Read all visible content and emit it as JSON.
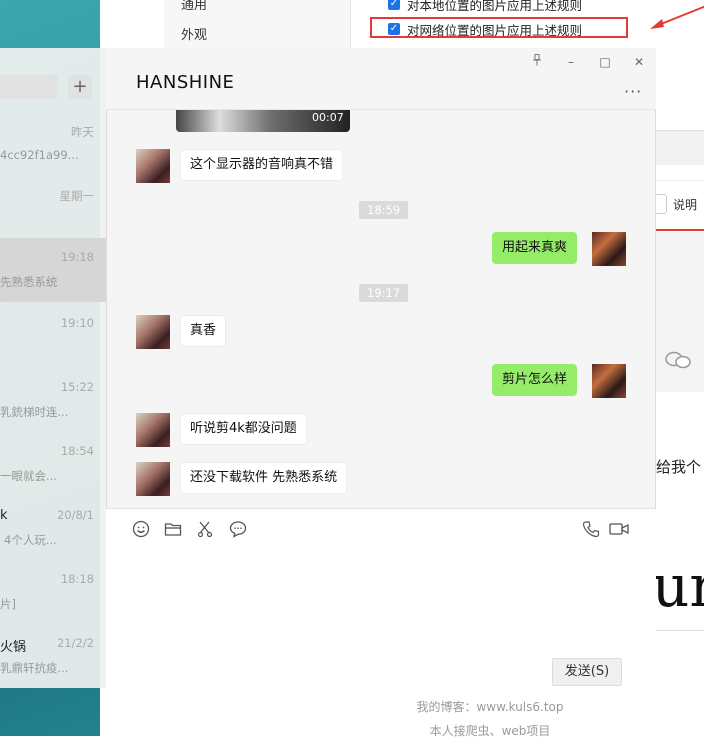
{
  "settings": {
    "nav_items": [
      "通用",
      "外观"
    ],
    "options": [
      {
        "label": "对本地位置的图片应用上述规则",
        "checked": true
      },
      {
        "label": "对网络位置的图片应用上述规则",
        "checked": true
      }
    ],
    "explain_label": "说明"
  },
  "background_page": {
    "give_text": "给我个",
    "signature": "ur",
    "blog_line": "我的博客：www.kuls6.top",
    "service_line": "本人接爬虫、web项目"
  },
  "chat_list": {
    "add_label": "+",
    "items": [
      {
        "time": "昨天",
        "msg": "4cc92f1a99..."
      },
      {
        "time": "星期一",
        "msg": ""
      },
      {
        "time": "19:18",
        "msg": "先熟悉系统",
        "selected": true
      },
      {
        "time": "19:10",
        "msg": ""
      },
      {
        "time": "15:22",
        "msg": "乳銃梯时连..."
      },
      {
        "time": "18:54",
        "msg": "一眼就会..."
      },
      {
        "time": "20/8/1",
        "name": "k",
        "msg": "4个人玩..."
      },
      {
        "time": "18:18",
        "msg": "片]"
      },
      {
        "time": "21/2/2",
        "name": "火锅",
        "msg": "乳鼎轩抗疫..."
      }
    ]
  },
  "chat": {
    "title": "HANSHINE",
    "window_controls": [
      "pin",
      "minimize",
      "maximize",
      "close"
    ],
    "video_duration": "00:07",
    "messages": [
      {
        "side": "left",
        "text": "这个显示器的音响真不错"
      },
      {
        "type": "time",
        "text": "18:59"
      },
      {
        "side": "right",
        "text": "用起来真爽"
      },
      {
        "type": "time",
        "text": "19:17"
      },
      {
        "side": "left",
        "text": "真香"
      },
      {
        "side": "right",
        "text": "剪片怎么样"
      },
      {
        "side": "left",
        "text": "听说剪4k都没问题"
      },
      {
        "side": "left",
        "text": "还没下载软件 先熟悉系统"
      }
    ],
    "toolbar": [
      "emoji-icon",
      "folder-icon",
      "scissors-icon",
      "chat-bubble-icon",
      "phone-icon",
      "video-call-icon"
    ],
    "send_label": "发送(S)"
  }
}
